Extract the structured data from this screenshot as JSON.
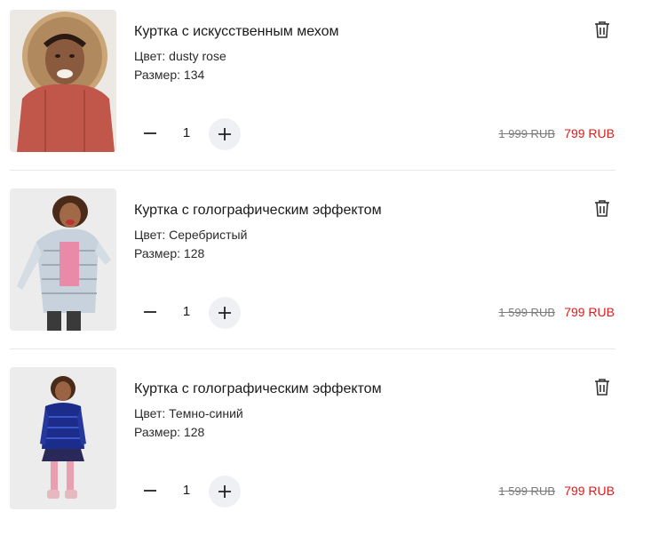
{
  "cart": {
    "color_label": "Цвет:",
    "size_label": "Размер:",
    "items": [
      {
        "title": "Куртка с искусственным мехом",
        "color": "dusty rose",
        "size": "134",
        "quantity": "1",
        "old_price": "1 999 RUB",
        "new_price": "799 RUB"
      },
      {
        "title": "Куртка с голографическим эффектом",
        "color": "Серебристый",
        "size": "128",
        "quantity": "1",
        "old_price": "1 599 RUB",
        "new_price": "799 RUB"
      },
      {
        "title": "Куртка с голографическим эффектом",
        "color": "Темно-синий",
        "size": "128",
        "quantity": "1",
        "old_price": "1 599 RUB",
        "new_price": "799 RUB"
      }
    ]
  },
  "colors": {
    "sale_price": "#d81e1e",
    "old_price": "#7a7a7a",
    "plus_button_bg": "#eef0f3",
    "divider": "#e8e8e8"
  },
  "icons": {
    "delete": "trash-icon",
    "decrease": "minus-icon",
    "increase": "plus-icon"
  }
}
